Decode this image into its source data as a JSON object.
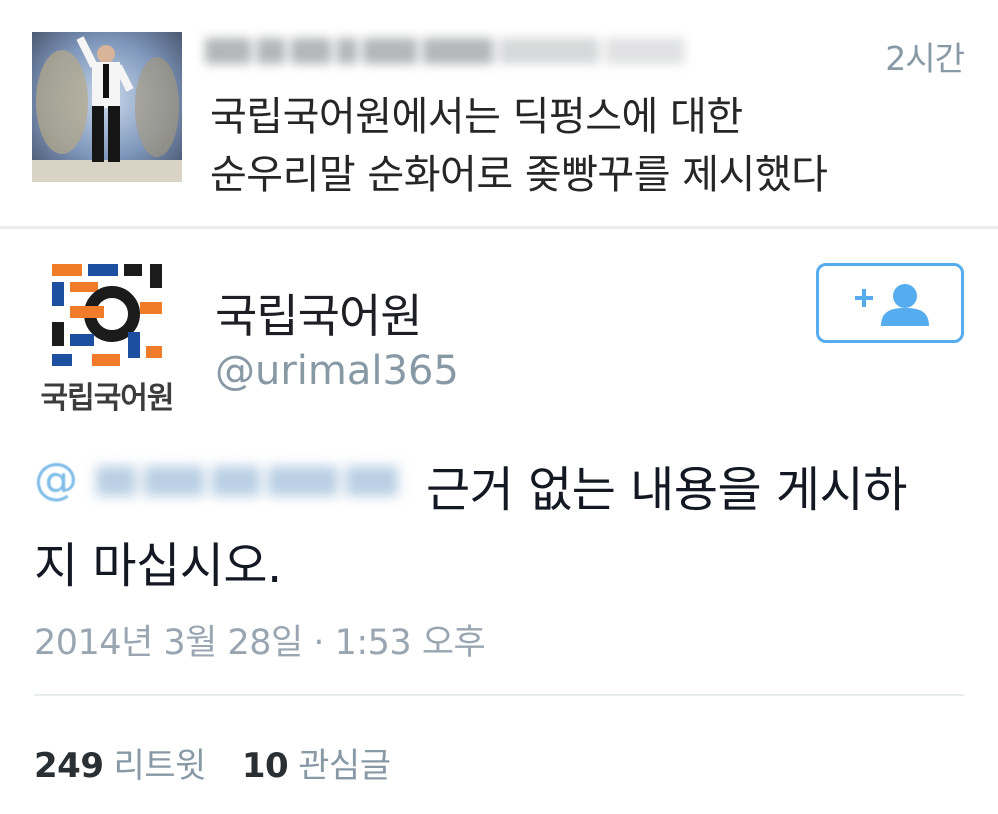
{
  "quoted_tweet": {
    "time": "2시간",
    "text_line1": "국립국어원에서는 딕펑스에 대한",
    "text_line2": "순우리말 순화어로 좆빵꾸를 제시했다"
  },
  "tweet": {
    "display_name": "국립국어원",
    "handle": "@urimal365",
    "logo_label": "국립국어원",
    "mention_prefix": "@",
    "text": "근거 없는 내용을 게시하지 마십시오.",
    "timestamp": "2014년 3월 28일 · 1:53 오후",
    "retweet_count": "249",
    "retweet_label": "리트윗",
    "favorite_count": "10",
    "favorite_label": "관심글"
  },
  "icons": {
    "follow": "add-user-icon"
  },
  "colors": {
    "accent": "#55acee",
    "muted_text": "#8899a6",
    "logo_orange": "#f07c2a",
    "logo_blue": "#1d4fa0",
    "logo_black": "#1b1b1b"
  }
}
